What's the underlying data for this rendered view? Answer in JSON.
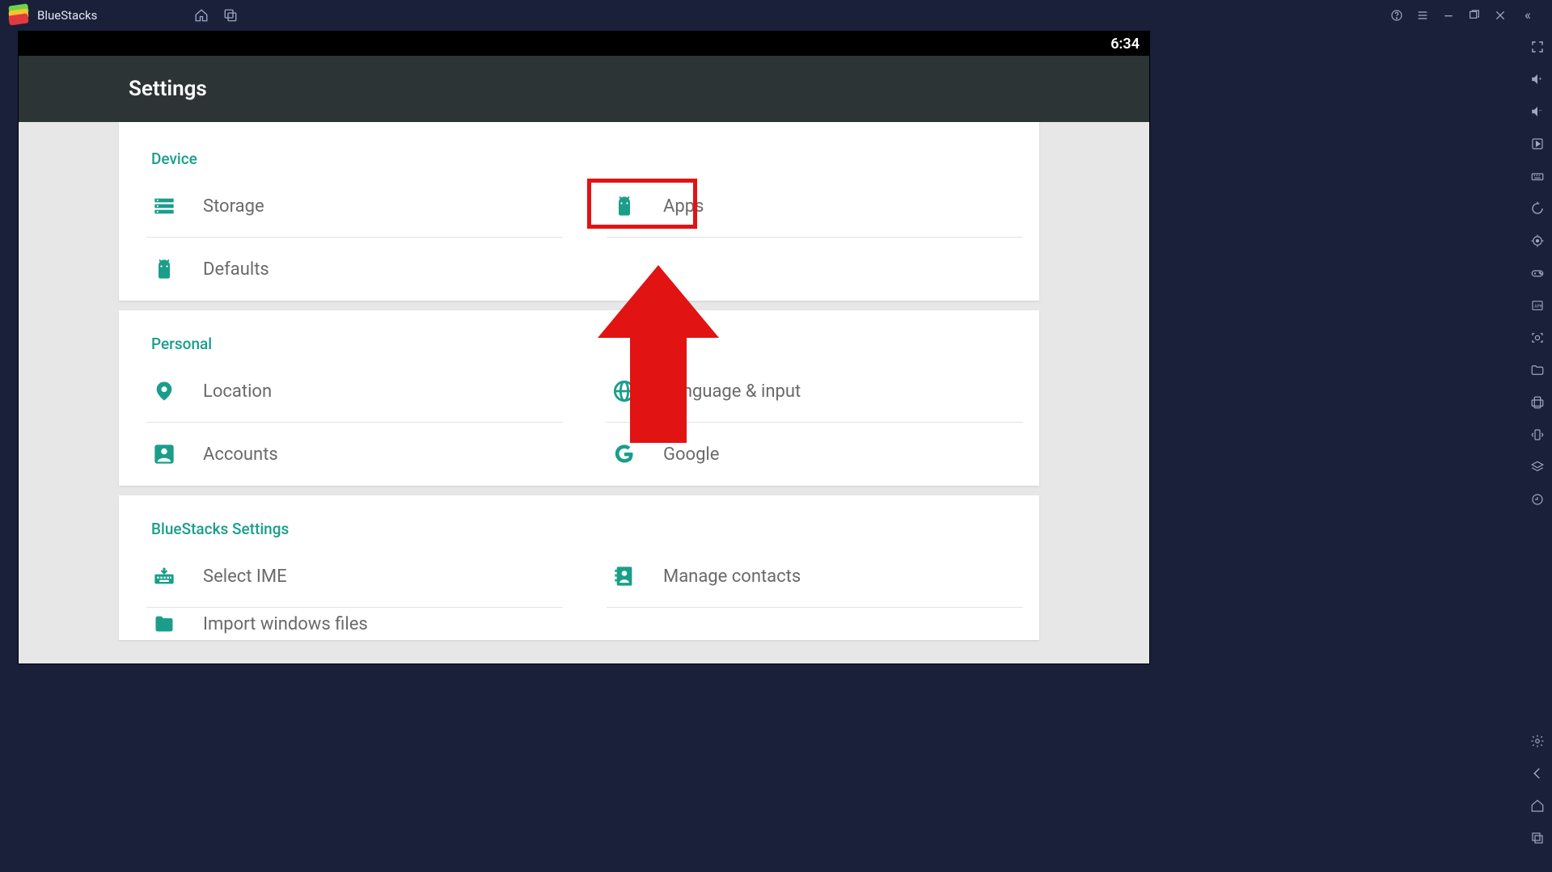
{
  "app": {
    "name": "BlueStacks"
  },
  "android": {
    "clock": "6:34"
  },
  "settings": {
    "title": "Settings",
    "sections": [
      {
        "title": "Device",
        "items": [
          {
            "label": "Storage"
          },
          {
            "label": "Apps"
          },
          {
            "label": "Defaults"
          }
        ]
      },
      {
        "title": "Personal",
        "items": [
          {
            "label": "Location"
          },
          {
            "label": "Language & input"
          },
          {
            "label": "Accounts"
          },
          {
            "label": "Google"
          }
        ]
      },
      {
        "title": "BlueStacks Settings",
        "items": [
          {
            "label": "Select IME"
          },
          {
            "label": "Manage contacts"
          },
          {
            "label": "Import windows files"
          }
        ]
      }
    ]
  }
}
